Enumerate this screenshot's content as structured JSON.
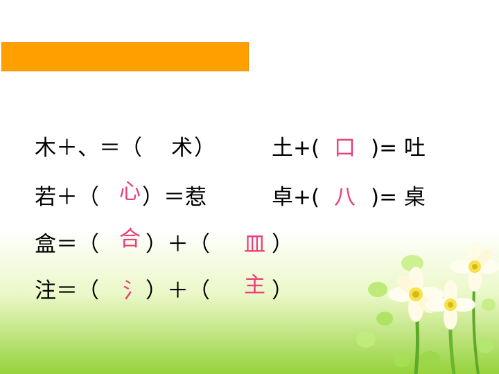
{
  "colors": {
    "title_bar": "#ff9f00",
    "text": "#000000",
    "answer": "#e8407a",
    "background_bottom": "#96d23c"
  },
  "title_bar": {
    "text": ""
  },
  "rows": {
    "r1": {
      "left_prefix": "木＋、＝（",
      "left_answer": "术",
      "left_suffix": "）",
      "right_prefix": "土+(",
      "right_answer": "口",
      "right_suffix": ")= 吐"
    },
    "r2": {
      "left_prefix": "若＋（",
      "left_answer": "心",
      "left_suffix": "）＝惹",
      "right_prefix": "卓+(",
      "right_answer": "八",
      "right_suffix": ")= 桌"
    },
    "r3": {
      "prefix": "盒＝（",
      "answer1": "合",
      "middle": "）＋（",
      "answer2": "皿",
      "suffix": "）"
    },
    "r4": {
      "prefix": "注＝（",
      "answer1": "氵",
      "middle": "）＋（",
      "answer2": "主",
      "suffix": "）"
    }
  },
  "decoration": {
    "icon": "daffodil-flowers-icon"
  }
}
